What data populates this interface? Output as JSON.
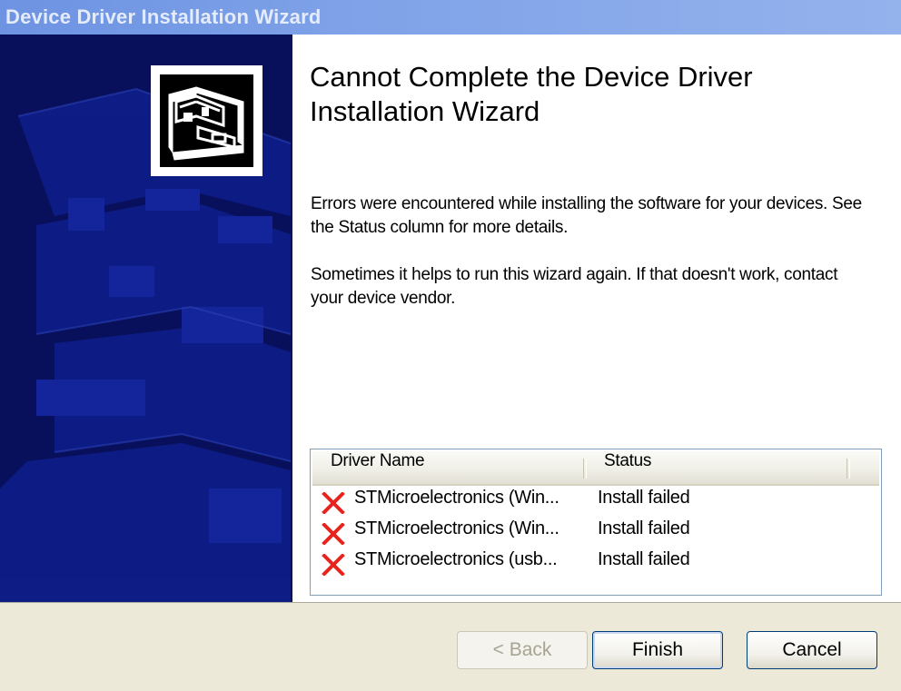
{
  "window": {
    "title": "Device Driver Installation Wizard"
  },
  "page": {
    "heading": "Cannot Complete the Device Driver Installation Wizard",
    "paragraph1": "Errors were encountered while installing the software for your devices. See the Status column for more details.",
    "paragraph2": "Sometimes it helps to run this wizard again. If that doesn't work, contact your device vendor."
  },
  "driver_list": {
    "columns": [
      "Driver Name",
      "Status"
    ],
    "rows": [
      {
        "name": "STMicroelectronics (Win...",
        "status": "Install failed",
        "icon": "error-x-icon"
      },
      {
        "name": "STMicroelectronics (Win...",
        "status": "Install failed",
        "icon": "error-x-icon"
      },
      {
        "name": "STMicroelectronics (usb...",
        "status": "Install failed",
        "icon": "error-x-icon"
      }
    ]
  },
  "buttons": {
    "back": "< Back",
    "finish": "Finish",
    "cancel": "Cancel"
  },
  "colors": {
    "side_panel": "#08105c",
    "error_icon": "#e8221c",
    "titlebar": "#7fa2e8"
  }
}
